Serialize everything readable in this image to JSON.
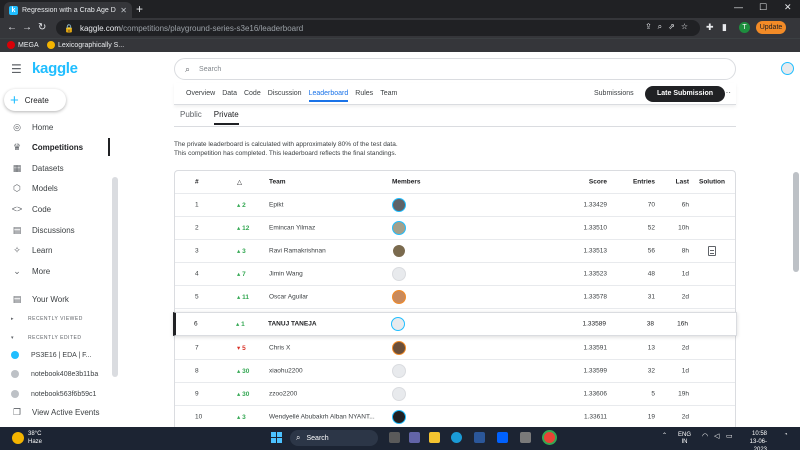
{
  "browser": {
    "tab_title": "Regression with a Crab Age Data...",
    "url_host": "kaggle.com",
    "url_path": "/competitions/playground-series-s3e16/leaderboard",
    "update_label": "Update",
    "profile_initial": "T",
    "bookmarks": [
      {
        "label": "MEGA",
        "color": "#d90007"
      },
      {
        "label": "Lexicographically S...",
        "color": "#f4b400"
      }
    ]
  },
  "sidebar": {
    "logo": "kaggle",
    "create_label": "Create",
    "items": [
      {
        "label": "Home",
        "icon": "compass-icon"
      },
      {
        "label": "Competitions",
        "icon": "trophy-icon"
      },
      {
        "label": "Datasets",
        "icon": "table-icon"
      },
      {
        "label": "Models",
        "icon": "models-icon"
      },
      {
        "label": "Code",
        "icon": "code-icon"
      },
      {
        "label": "Discussions",
        "icon": "comments-icon"
      },
      {
        "label": "Learn",
        "icon": "graduation-icon"
      },
      {
        "label": "More",
        "icon": "chevron-down-icon"
      }
    ],
    "your_work": "Your Work",
    "recently_viewed": "RECENTLY VIEWED",
    "recently_edited": "RECENTLY EDITED",
    "recent_items": [
      "PS3E16 | EDA | F...",
      "notebook408e3b11ba",
      "notebook563f6b59c1"
    ],
    "view_active_events": "View Active Events"
  },
  "search": {
    "placeholder": "Search"
  },
  "tabs": {
    "items": [
      "Overview",
      "Data",
      "Code",
      "Discussion",
      "Leaderboard",
      "Rules",
      "Team"
    ],
    "active": "Leaderboard",
    "submissions": "Submissions",
    "late_submission": "Late Submission"
  },
  "board_tabs": {
    "public": "Public",
    "private": "Private"
  },
  "description": {
    "line1": "The private leaderboard is calculated with approximately 80% of the test data.",
    "line2": "This competition has completed. This leaderboard reflects the final standings."
  },
  "leaderboard": {
    "headers": {
      "rank": "#",
      "delta": "△",
      "team": "Team",
      "members": "Members",
      "score": "Score",
      "entries": "Entries",
      "last": "Last",
      "solution": "Solution"
    },
    "rows": [
      {
        "rank": "1",
        "delta": "2",
        "dir": "up",
        "team": "Epikt",
        "score": "1.33429",
        "entries": "70",
        "last": "6h"
      },
      {
        "rank": "2",
        "delta": "12",
        "dir": "up",
        "team": "Emincan Yilmaz",
        "score": "1.33510",
        "entries": "52",
        "last": "10h"
      },
      {
        "rank": "3",
        "delta": "3",
        "dir": "up",
        "team": "Ravi Ramakrishnan",
        "score": "1.33513",
        "entries": "56",
        "last": "8h",
        "solution": true
      },
      {
        "rank": "4",
        "delta": "7",
        "dir": "up",
        "team": "Jimin Wang",
        "score": "1.33523",
        "entries": "48",
        "last": "1d"
      },
      {
        "rank": "5",
        "delta": "11",
        "dir": "up",
        "team": "Oscar Aguilar",
        "score": "1.33578",
        "entries": "31",
        "last": "2d"
      }
    ],
    "me": {
      "rank": "6",
      "delta": "1",
      "dir": "up",
      "team": "TANUJ TANEJA",
      "score": "1.33589",
      "entries": "38",
      "last": "16h"
    },
    "rows_after": [
      {
        "rank": "7",
        "delta": "5",
        "dir": "down",
        "team": "Chris X",
        "score": "1.33591",
        "entries": "13",
        "last": "2d"
      },
      {
        "rank": "8",
        "delta": "30",
        "dir": "up",
        "team": "xiaohu2200",
        "score": "1.33599",
        "entries": "32",
        "last": "1d"
      },
      {
        "rank": "9",
        "delta": "30",
        "dir": "up",
        "team": "zzoo2200",
        "score": "1.33606",
        "entries": "5",
        "last": "19h"
      },
      {
        "rank": "10",
        "delta": "3",
        "dir": "up",
        "team": "Wendyellé Abubakrh Alban NYANT...",
        "score": "1.33611",
        "entries": "19",
        "last": "2d"
      }
    ]
  },
  "taskbar": {
    "temp": "38°C",
    "weather": "Haze",
    "search": "Search",
    "lang1": "ENG",
    "lang2": "IN",
    "time": "10:58",
    "date": "13-06-2023"
  }
}
